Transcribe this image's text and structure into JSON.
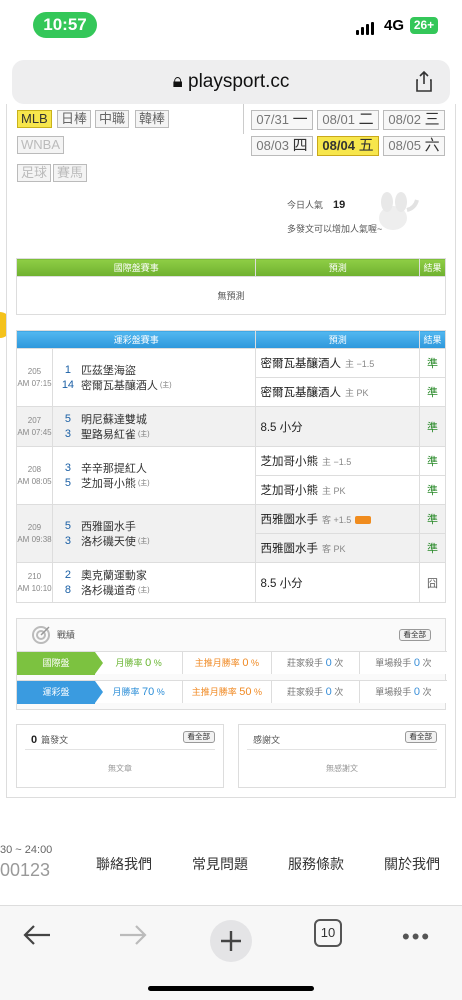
{
  "status": {
    "time": "10:57",
    "network": "4G",
    "battery": "26+"
  },
  "browser": {
    "domain": "playsport.cc"
  },
  "leagues": [
    "MLB",
    "日棒",
    "中職",
    "韓棒",
    "WNBA",
    "足球",
    "賽馬"
  ],
  "dates": [
    {
      "date": "07/31",
      "day": "一"
    },
    {
      "date": "08/01",
      "day": "二"
    },
    {
      "date": "08/02",
      "day": "三"
    },
    {
      "date": "08/03",
      "day": "四"
    },
    {
      "date": "08/04",
      "day": "五"
    },
    {
      "date": "08/05",
      "day": "六"
    }
  ],
  "popularity": {
    "label": "今日人氣",
    "value": "19",
    "hint": "多發文可以增加人氣喔~"
  },
  "intl": {
    "h_match": "國際盤賽事",
    "h_pred": "預測",
    "h_result": "結果",
    "none": "無預測"
  },
  "lottery": {
    "h_match": "運彩盤賽事",
    "h_pred": "預測",
    "h_result": "結果"
  },
  "games": [
    {
      "no": "205",
      "time": "AM 07:15",
      "away_no": "1",
      "away": "匹茲堡海盜",
      "home_no": "14",
      "home": "密爾瓦基釀酒人",
      "home_tag": "(主)",
      "preds": [
        {
          "pick": "密爾瓦基釀酒人",
          "sub": "主 −1.5",
          "res": "準"
        },
        {
          "pick": "密爾瓦基釀酒人",
          "sub": "主 PK",
          "res": "準"
        }
      ]
    },
    {
      "no": "207",
      "time": "AM 07:45",
      "away_no": "5",
      "away": "明尼蘇達雙城",
      "home_no": "3",
      "home": "聖路易紅雀",
      "home_tag": "(主)",
      "preds": [
        {
          "pick": "8.5 小分",
          "sub": "",
          "res": "準"
        }
      ]
    },
    {
      "no": "208",
      "time": "AM 08:05",
      "away_no": "3",
      "away": "辛辛那提紅人",
      "home_no": "5",
      "home": "芝加哥小熊",
      "home_tag": "(主)",
      "preds": [
        {
          "pick": "芝加哥小熊",
          "sub": "主 −1.5",
          "res": "準"
        },
        {
          "pick": "芝加哥小熊",
          "sub": "主 PK",
          "res": "準"
        }
      ]
    },
    {
      "no": "209",
      "time": "AM 09:38",
      "away_no": "5",
      "away": "西雅圖水手",
      "home_no": "3",
      "home": "洛杉磯天使",
      "home_tag": "(主)",
      "preds": [
        {
          "pick": "西雅圖水手",
          "sub": "客 +1.5",
          "res": "準"
        },
        {
          "pick": "西雅圖水手",
          "sub": "客 PK",
          "res": "準"
        }
      ]
    },
    {
      "no": "210",
      "time": "AM 10:10",
      "away_no": "2",
      "away": "奧克蘭運動家",
      "home_no": "8",
      "home": "洛杉磯道奇",
      "home_tag": "(主)",
      "preds": [
        {
          "pick": "8.5 小分",
          "sub": "",
          "res": "囧"
        }
      ]
    }
  ],
  "stats": {
    "title": "戰績",
    "view_all": "看全部",
    "rows": [
      {
        "label": "國際盤",
        "monthly": "月勝率",
        "monthly_v": "0",
        "main": "主推月勝率",
        "main_v": "0",
        "dealer": "莊家殺手",
        "dealer_v": "0",
        "single": "單場殺手",
        "single_v": "0"
      },
      {
        "label": "運彩盤",
        "monthly": "月勝率",
        "monthly_v": "70",
        "main": "主推月勝率",
        "main_v": "50",
        "dealer": "莊家殺手",
        "dealer_v": "0",
        "single": "單場殺手",
        "single_v": "0"
      }
    ],
    "pct": "%",
    "count_unit": "次"
  },
  "posts": {
    "count": "0",
    "label": "篇發文",
    "view_all": "看全部",
    "empty": "無文章"
  },
  "thanks": {
    "label": "感謝文",
    "view_all": "看全部",
    "empty": "無感謝文"
  },
  "footer": {
    "hours": "30 ~ 24:00",
    "phone": "00123",
    "links": [
      "聯絡我們",
      "常見問題",
      "服務條款",
      "關於我們"
    ]
  },
  "toolbar": {
    "tabs_count": "10"
  }
}
